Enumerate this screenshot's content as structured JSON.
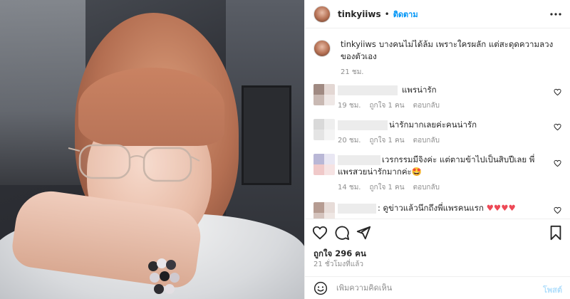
{
  "post": {
    "username": "tinkyiiws",
    "separator": "•",
    "follow_label": "ติดตาม",
    "more_icon": "more-horizontal-icon"
  },
  "caption": {
    "username": "tinkyiiws",
    "text": "บางคนไม่ได้ล้ม เพราะใครผลัก แต่สะดุดความลวงของตัวเอง",
    "time": "21 ชม."
  },
  "comments": [
    {
      "text": "แพรน่ารัก",
      "time": "19 ชม.",
      "likes": "ถูกใจ 1 คน",
      "reply": "ตอบกลับ",
      "avatar_colors": [
        "#a08a82",
        "#e3d7d3",
        "#c9b9b3",
        "#efe8e6"
      ]
    },
    {
      "text": "น่ารักมากเลยค่ะคนน่ารัก",
      "time": "20 ชม.",
      "likes": "ถูกใจ 1 คน",
      "reply": "ตอบกลับ",
      "avatar_colors": [
        "#d9d9d9",
        "#eeeeee",
        "#e4e4e4",
        "#f4f4f4"
      ]
    },
    {
      "text": "เวรกรรมมีจิงค่ะ แต่ตามข้าไปเป็นสิบปีเลย พี่แพรสวยน่ารักมากค่ะ🤩",
      "time": "14 ชม.",
      "likes": "ถูกใจ 1 คน",
      "reply": "ตอบกลับ",
      "avatar_colors": [
        "#b9b7d6",
        "#e9e7f3",
        "#f0c9c9",
        "#f6e3e3"
      ]
    },
    {
      "text": ": ดูข่าวแล้วนึกถึงพี่แพรคนแรก ♥♥♥♥",
      "time": "",
      "likes": "",
      "reply": "",
      "avatar_colors": [
        "#b69c92",
        "#e7dcd8",
        "#d4c3bd",
        "#efe7e4"
      ]
    }
  ],
  "actions": {
    "like_icon": "heart-icon",
    "comment_icon": "comment-icon",
    "share_icon": "send-icon",
    "save_icon": "bookmark-icon"
  },
  "likes_text": "ถูกใจ 296 คน",
  "timestamp": "21 ชั่วโมงที่แล้ว",
  "add_comment": {
    "placeholder": "เพิ่มความคิดเห็น",
    "post_label": "โพสต์",
    "emoji_icon": "emoji-icon"
  },
  "colors": {
    "accent": "#0095f6",
    "post_disabled": "#b2dffc",
    "heart_red": "#ed4956",
    "muted": "#8e8e8e"
  }
}
